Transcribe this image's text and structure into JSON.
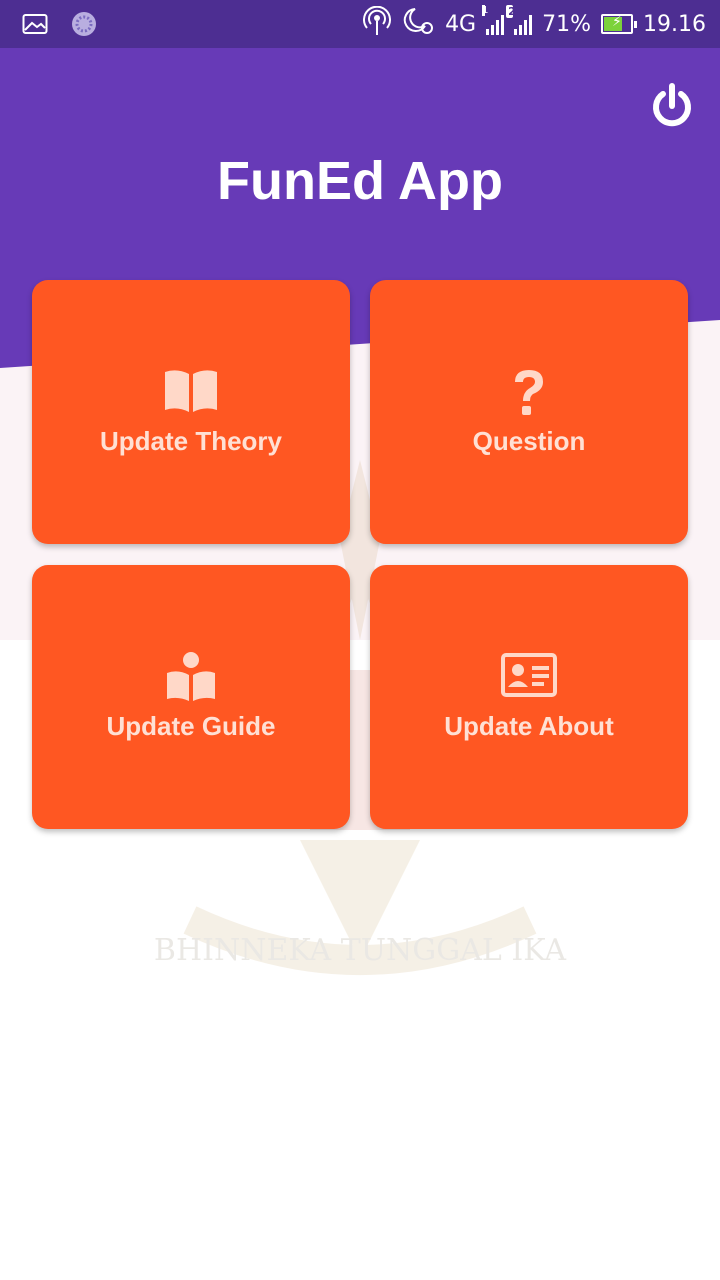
{
  "status_bar": {
    "network": "4G",
    "sim1_tag": "1",
    "sim2_tag": "2",
    "battery_percent": "71%",
    "battery_level": 0.71,
    "time": "19.16"
  },
  "header": {
    "title": "FunEd App",
    "power_icon": "power-icon"
  },
  "menu": [
    {
      "label": "Update Theory",
      "icon": "book-open-icon"
    },
    {
      "label": "Question",
      "icon": "question-icon"
    },
    {
      "label": "Update Guide",
      "icon": "reader-icon"
    },
    {
      "label": "Update About",
      "icon": "id-card-icon"
    }
  ],
  "background": {
    "watermark_text": "BHINNEKA TUNGGAL IKA"
  },
  "colors": {
    "status_bar": "#4d2e92",
    "header": "#673ab7",
    "card": "#ff5722",
    "card_text": "#ffe0d4"
  }
}
